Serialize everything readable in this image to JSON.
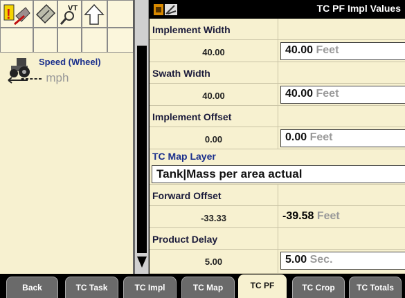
{
  "header": {
    "title": "TC PF Impl Values"
  },
  "toolbar": {
    "icons": [
      "warning-alarm-icon",
      "eraser-icon",
      "vt-search-icon",
      "up-arrow-icon"
    ]
  },
  "speed": {
    "label": "Speed (Wheel)",
    "value": "-----",
    "unit": "mph",
    "icon": "tractor-icon"
  },
  "rows": {
    "implement_width": {
      "label": "Implement Width",
      "value": "40.00",
      "input": "40.00",
      "unit": "Feet"
    },
    "swath_width": {
      "label": "Swath Width",
      "value": "40.00",
      "input": "40.00",
      "unit": "Feet"
    },
    "implement_offset": {
      "label": "Implement Offset",
      "value": "0.00",
      "input": "0.00",
      "unit": "Feet"
    },
    "map_layer": {
      "label": "TC Map Layer",
      "value": "Tank|Mass per area actual"
    },
    "forward_offset": {
      "label": "Forward Offset",
      "value": "-33.33",
      "input": "-39.58",
      "unit": "Feet"
    },
    "product_delay": {
      "label": "Product Delay",
      "value": "5.00",
      "input": "5.00",
      "unit": "Sec."
    }
  },
  "tabs": {
    "back": "Back",
    "tc_task": "TC Task",
    "tc_impl": "TC Impl",
    "tc_map": "TC Map",
    "tc_pf": "TC PF",
    "tc_crop": "TC Crop",
    "tc_totals": "TC Totals"
  },
  "colors": {
    "panel": "#f7f1d0",
    "label_blue": "#1a2f8c",
    "tab": "#6a6a6a"
  }
}
